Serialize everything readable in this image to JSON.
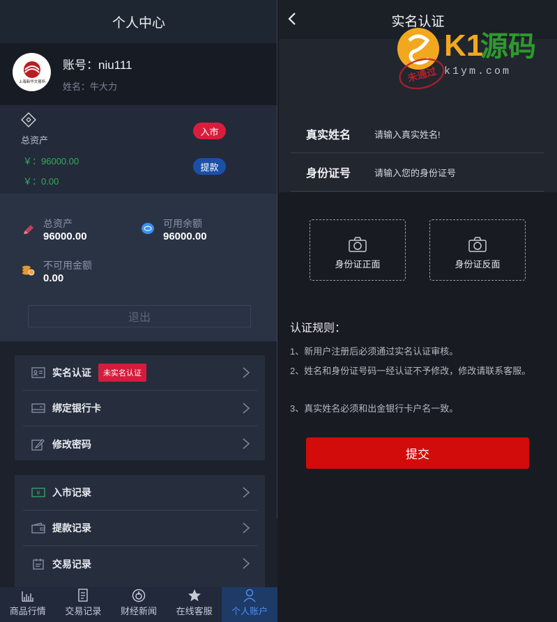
{
  "left": {
    "title": "个人中心",
    "profile": {
      "account": "账号：niu111",
      "name": "姓名：牛大力",
      "avatar_text": "上海新华文易所"
    },
    "assets": {
      "label": "总资产",
      "value1": "￥：96000.00",
      "value2": "￥：0.00",
      "enter_button": "入市",
      "withdraw_button": "提款"
    },
    "stats": {
      "total_label": "总资产",
      "total_value": "96000.00",
      "available_label": "可用余额",
      "available_value": "96000.00",
      "unavailable_label": "不可用金额",
      "unavailable_value": "0.00"
    },
    "logout": "退出",
    "menu_group1": [
      {
        "label": "实名认证",
        "badge": "未实名认证"
      },
      {
        "label": "绑定银行卡"
      },
      {
        "label": "修改密码"
      }
    ],
    "menu_group2": [
      {
        "label": "入市记录"
      },
      {
        "label": "提款记录"
      },
      {
        "label": "交易记录"
      }
    ],
    "nav": [
      {
        "label": "商品行情",
        "icon": "chart-icon"
      },
      {
        "label": "交易记录",
        "icon": "document-icon"
      },
      {
        "label": "财经新闻",
        "icon": "power-circle-icon"
      },
      {
        "label": "在线客服",
        "icon": "star-icon"
      },
      {
        "label": "个人账户",
        "icon": "user-icon"
      }
    ],
    "active_nav": "个人账户"
  },
  "right": {
    "title": "实名认证",
    "fields": [
      {
        "label": "真实姓名",
        "placeholder": "请输入真实姓名!"
      },
      {
        "label": "身份证号",
        "placeholder": "请输入您的身份证号"
      }
    ],
    "uploads": [
      {
        "label": "身份证正面"
      },
      {
        "label": "身份证反面"
      }
    ],
    "rules_title": "认证规则：",
    "rules": [
      "1、新用户注册后必须通过实名认证审核。",
      "2、姓名和身份证号码一经认证不予修改，修改请联系客服。",
      "3、真实姓名必须和出金银行卡户名一致。"
    ],
    "submit": "提交"
  },
  "watermark": {
    "brand": "K1源码",
    "site": "k1ym.com",
    "stamp": "未通过"
  },
  "colors": {
    "accent_red": "#d20b0b",
    "badge_red": "#d41c3c",
    "green": "#2fae57",
    "blue": "#1b4fa8",
    "nav_active": "#4d8ff0"
  }
}
